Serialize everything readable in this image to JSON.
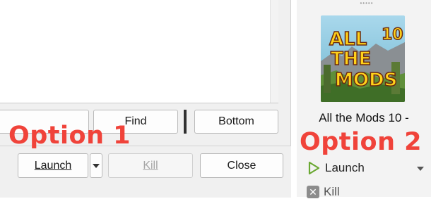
{
  "log_window": {
    "find_button": "Find",
    "bottom_button": "Bottom",
    "launch_button": "Launch",
    "kill_button": "Kill",
    "close_button": "Close"
  },
  "annotations": {
    "option1": "Option 1",
    "option2": "Option 2"
  },
  "sidebar": {
    "instance_art_text": [
      "ALL",
      "10",
      "THE",
      "MODS"
    ],
    "instance_name": "All the Mods 10 -",
    "launch_action": "Launch",
    "kill_action": "Kill"
  },
  "colors": {
    "annotation": "#f0433a",
    "launch_icon": "#6aa832",
    "art_text": "#ffd21a"
  }
}
